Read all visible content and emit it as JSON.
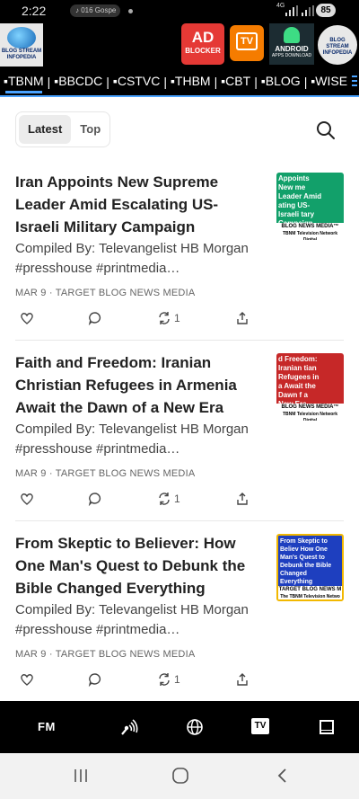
{
  "status_bar": {
    "time": "2:22",
    "media_label": "016 Gospe",
    "network": "4G",
    "battery": "85"
  },
  "banner": {
    "logo_left_text": "BLOG STREAM INFOPEDIA",
    "adblocker_big": "AD",
    "adblocker_small": "BLOCKER",
    "tv_label": "TV",
    "android_title": "ANDROID",
    "android_sub": "APPS DOWNLOAD",
    "logo_right_text": "BLOG STREAM INFOPEDIA"
  },
  "channels": [
    "▪TBNM",
    "▪BBCDC",
    "▪CSTVC",
    "▪THBM",
    "▪CBT",
    "▪BLOG",
    "▪WISE"
  ],
  "feed_tabs": {
    "latest": "Latest",
    "top": "Top"
  },
  "articles": [
    {
      "title": "Iran Appoints New Supreme Leader Amid Escalating US-Israeli Military Campaign",
      "subtitle": "Compiled By: Televangelist HB Morgan #presshouse #printmedia…",
      "meta": "MAR 9 · TARGET BLOG NEWS MEDIA",
      "restack_count": "1",
      "thumb_caption": "Appoints New me Leader Amid ating US-Israeli tary Campaign",
      "thumb_strip": "BLOG NEWS MEDIA™",
      "thumb_strip_small": "TBNM Television Network Digital",
      "thumb_color": "#12a06a"
    },
    {
      "title": "Faith and Freedom: Iranian Christian Refugees in Armenia Await the Dawn of a New Era",
      "subtitle": "Compiled By: Televangelist HB Morgan #presshouse #printmedia…",
      "meta": "MAR 9 · TARGET BLOG NEWS MEDIA",
      "restack_count": "1",
      "thumb_caption": "d Freedom: Iranian tian Refugees in a Await the Dawn f a New Era",
      "thumb_strip": "BLOG NEWS MEDIA™",
      "thumb_strip_small": "TBNM Television Network Digital",
      "thumb_color": "#c62828"
    },
    {
      "title": "From Skeptic to Believer: How One Man's Quest to Debunk the Bible Changed Everything",
      "subtitle": "Compiled By: Televangelist HB Morgan #presshouse #printmedia…",
      "meta": "MAR 9 · TARGET BLOG NEWS MEDIA",
      "restack_count": "1",
      "thumb_caption": "From Skeptic to Believ How One Man's Quest to Debunk the Bible Changed Everything",
      "thumb_strip": "TARGET BLOG NEWS M",
      "thumb_strip_small": "The TBNM Television Netwo",
      "thumb_color": "#1e3fbf"
    }
  ],
  "toolbar": {
    "fm_label": "FM",
    "tv_label": "TV"
  }
}
